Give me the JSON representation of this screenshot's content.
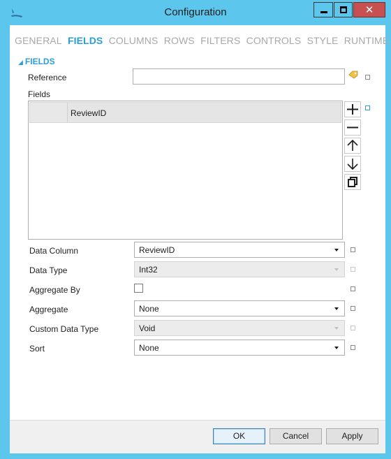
{
  "window": {
    "title": "Configuration",
    "close_glyph": "✕"
  },
  "tabs": [
    {
      "label": "GENERAL",
      "active": false
    },
    {
      "label": "FIELDS",
      "active": true
    },
    {
      "label": "COLUMNS",
      "active": false
    },
    {
      "label": "ROWS",
      "active": false
    },
    {
      "label": "FILTERS",
      "active": false
    },
    {
      "label": "CONTROLS",
      "active": false
    },
    {
      "label": "STYLE",
      "active": false
    },
    {
      "label": "RUNTIME",
      "active": false
    }
  ],
  "section": {
    "title": "FIELDS",
    "collapse_glyph": "◢"
  },
  "reference": {
    "label": "Reference",
    "value": "",
    "icon": "tag-icon"
  },
  "fields": {
    "label": "Fields",
    "items": [
      "ReviewID"
    ],
    "buttons": [
      "add-icon",
      "remove-icon",
      "move-up-icon",
      "move-down-icon",
      "copy-icon"
    ]
  },
  "properties": {
    "data_column": {
      "label": "Data Column",
      "value": "ReviewID",
      "disabled": false
    },
    "data_type": {
      "label": "Data Type",
      "value": "Int32",
      "disabled": true
    },
    "aggregate_by": {
      "label": "Aggregate By",
      "checked": false
    },
    "aggregate": {
      "label": "Aggregate",
      "value": "None",
      "disabled": false
    },
    "custom_data_type": {
      "label": "Custom Data Type",
      "value": "Void",
      "disabled": true
    },
    "sort": {
      "label": "Sort",
      "value": "None",
      "disabled": false
    }
  },
  "footer": {
    "ok": "OK",
    "cancel": "Cancel",
    "apply": "Apply"
  },
  "colors": {
    "chrome": "#5cc6ec",
    "accent": "#2a9fd6",
    "close": "#c75050"
  }
}
